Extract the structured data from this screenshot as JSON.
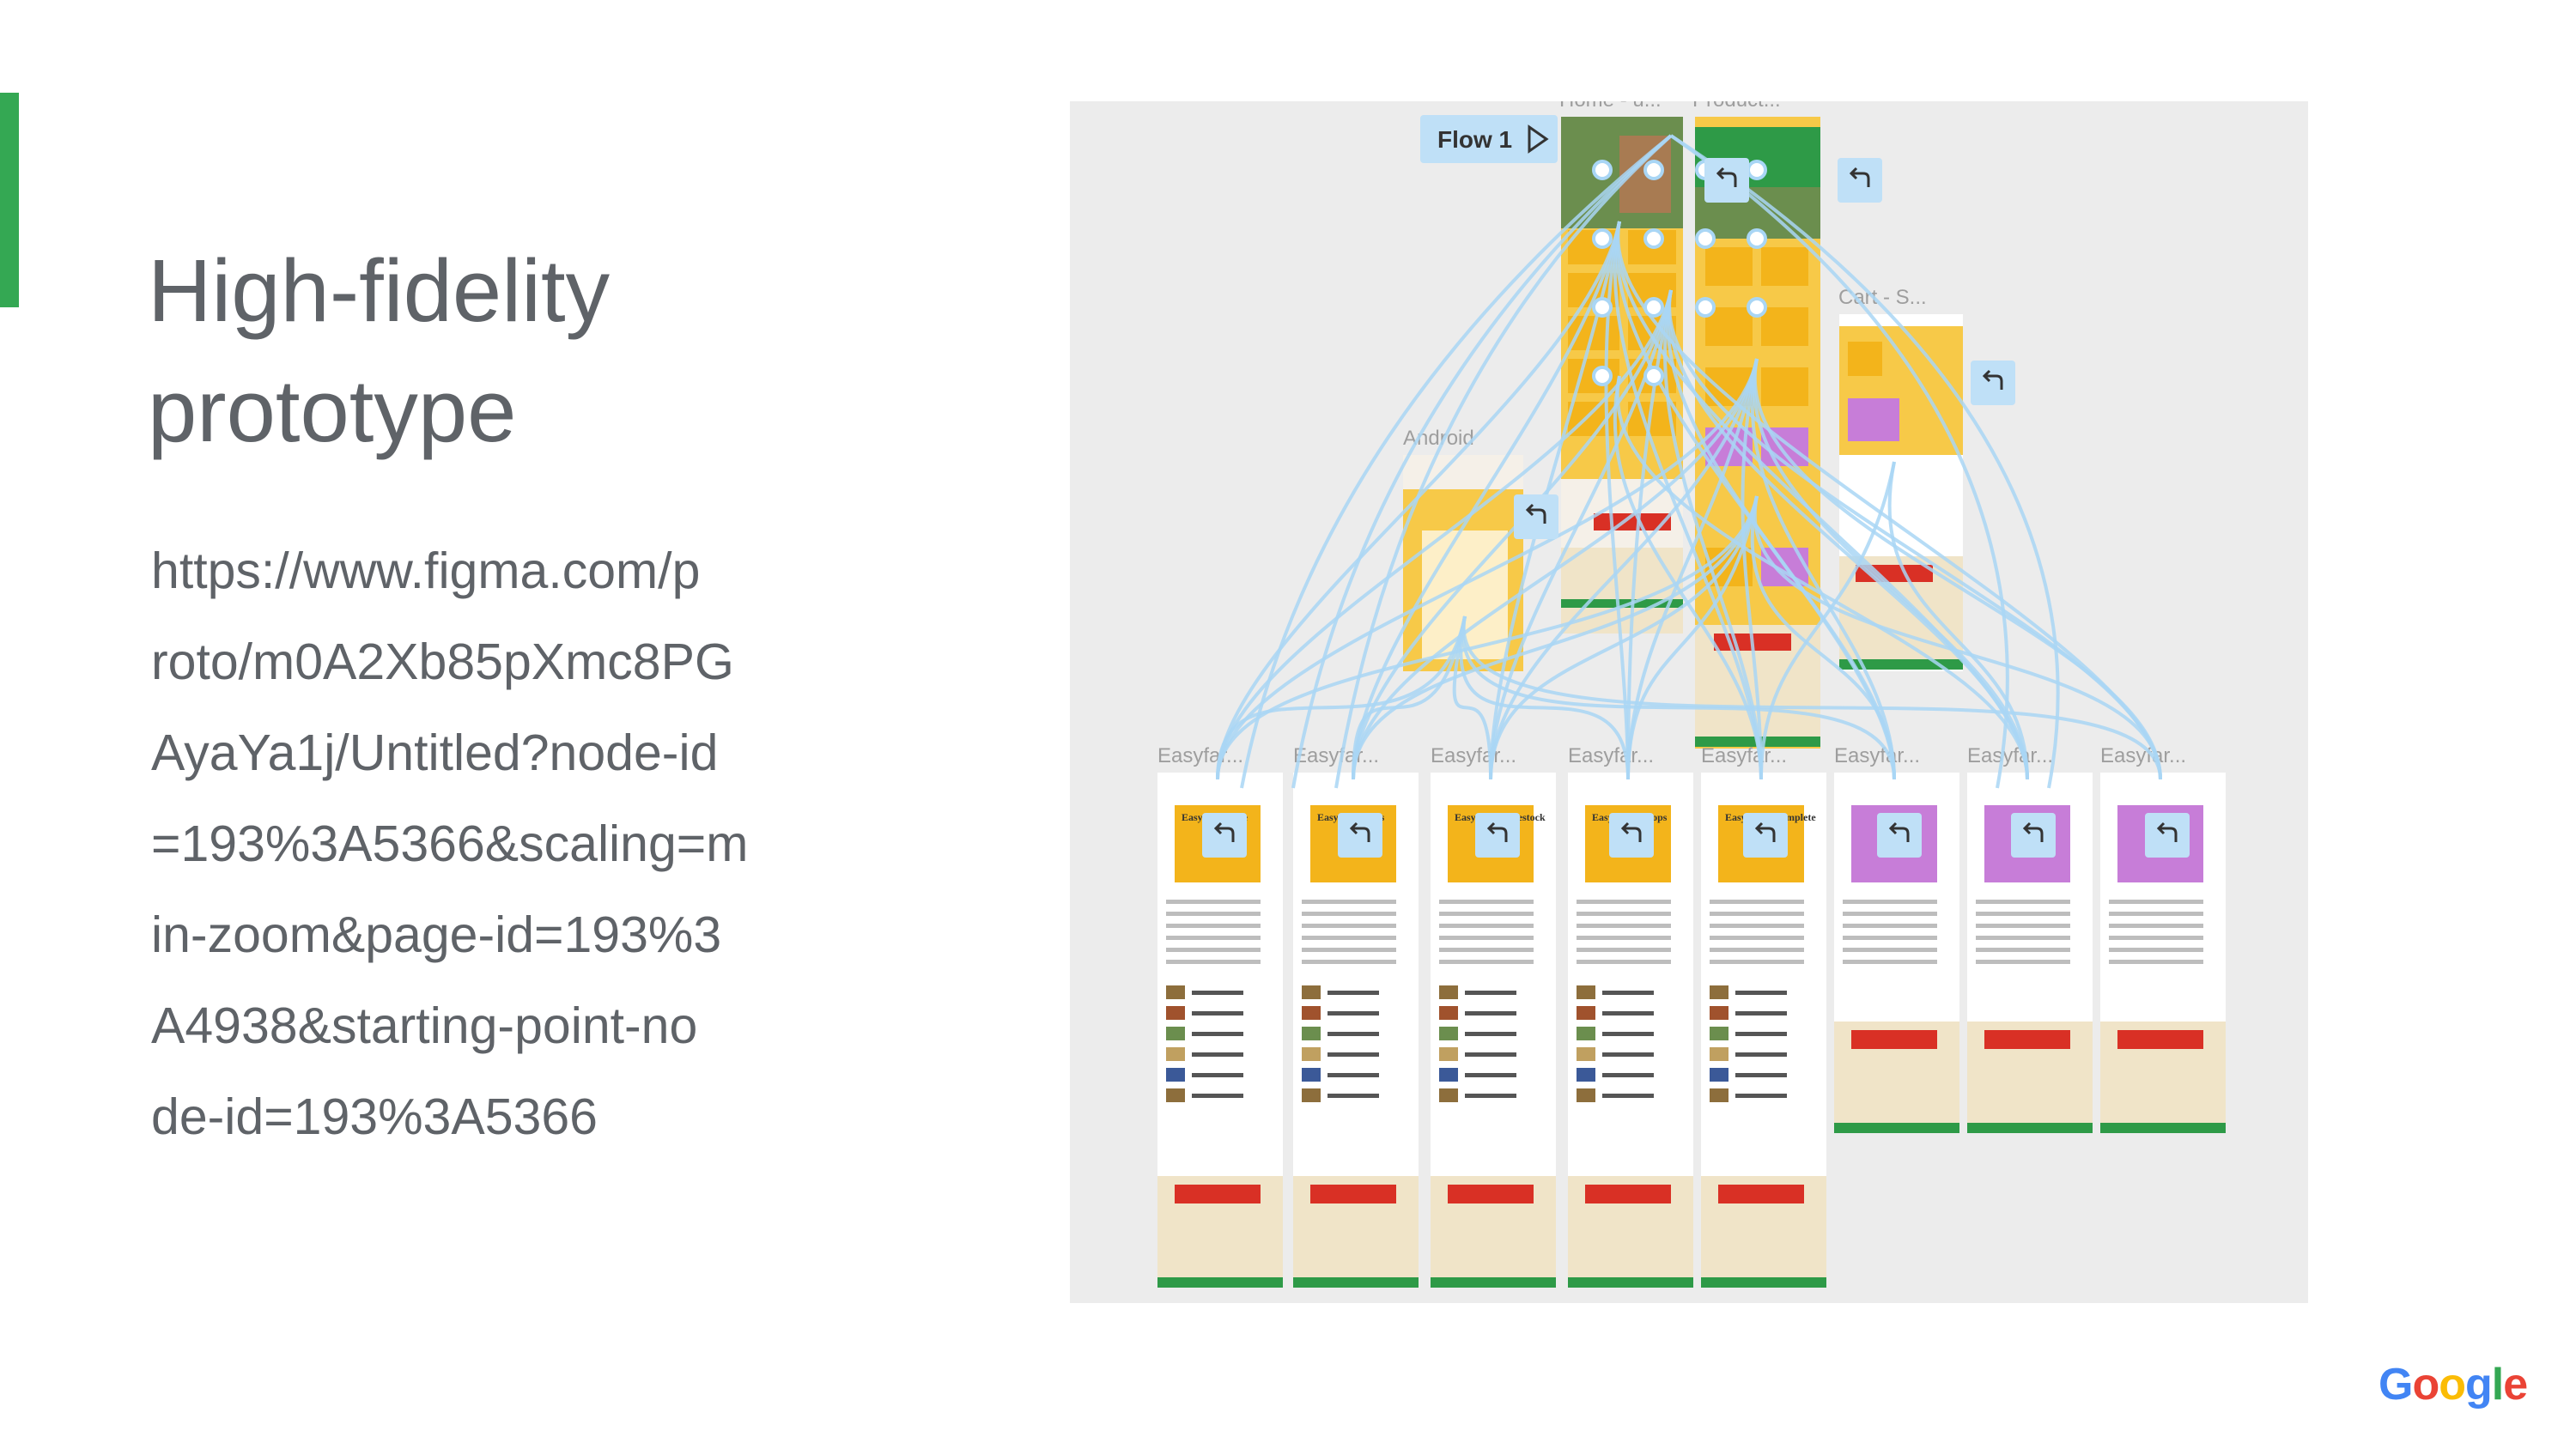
{
  "slide": {
    "title_lines": [
      "High-fidelity",
      "prototype"
    ],
    "url_lines": [
      "https://www.figma.com/p",
      "roto/m0A2Xb85pXmc8PG",
      "AyaYa1j/Untitled?node-id",
      "=193%3A5366&scaling=m",
      "in-zoom&page-id=193%3",
      "A4938&starting-point-no",
      "de-id=193%3A5366"
    ],
    "accent_color": "#34a853"
  },
  "figma": {
    "flow_label": "Flow 1",
    "flow_icon": "play-outline-icon",
    "back_icon": "back-arrow-icon",
    "frames": {
      "home": "Home - u...",
      "product": "Product...",
      "cart": "Cart - S...",
      "android": "Android",
      "easyfarm": "Easyfar..."
    },
    "card_labels": [
      "EasyFarm Lite",
      "EasyFarm Plus",
      "EasyFarm Livestock",
      "EasyFarm Crops",
      "EasyFarm Complete"
    ],
    "connector_color": "#a9d6f5"
  },
  "brand": {
    "logo_letters": [
      "G",
      "o",
      "o",
      "g",
      "l",
      "e"
    ],
    "logo_colors": [
      "#4285f4",
      "#ea4335",
      "#fbbc05",
      "#4285f4",
      "#34a853",
      "#ea4335"
    ]
  }
}
